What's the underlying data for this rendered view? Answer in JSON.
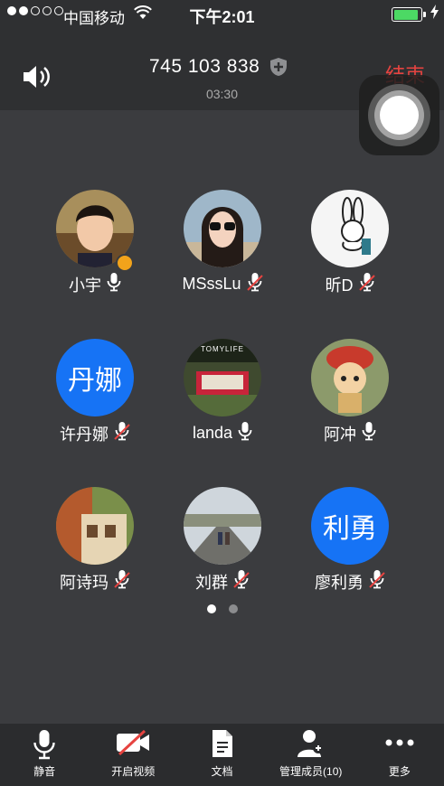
{
  "status_bar": {
    "carrier": "中国移动",
    "time": "下午2:01",
    "battery_level": 0.9,
    "colors": {
      "battery": "#4cd964"
    }
  },
  "call": {
    "meeting_id": "745 103 838",
    "duration": "03:30",
    "end_label_partial": "结束",
    "colors": {
      "end": "#e64340"
    }
  },
  "participants": [
    {
      "name": "小宇",
      "avatar": "photo",
      "host": true,
      "muted": false
    },
    {
      "name": "MSssLu",
      "avatar": "photo",
      "host": false,
      "muted": true
    },
    {
      "name": "昕D",
      "avatar": "photo",
      "host": false,
      "muted": true
    },
    {
      "name": "许丹娜",
      "avatar": "text",
      "avatar_text": "丹娜",
      "host": false,
      "muted": true
    },
    {
      "name": "landa",
      "avatar": "photo",
      "avatar_text": "TOMYLIFE",
      "host": false,
      "muted": false
    },
    {
      "name": "阿冲",
      "avatar": "photo",
      "host": false,
      "muted": false
    },
    {
      "name": "阿诗玛",
      "avatar": "photo",
      "host": false,
      "muted": true
    },
    {
      "name": "刘群",
      "avatar": "photo",
      "host": false,
      "muted": true
    },
    {
      "name": "廖利勇",
      "avatar": "text",
      "avatar_text": "利勇",
      "host": false,
      "muted": true
    }
  ],
  "pager": {
    "pages": 2,
    "current": 1
  },
  "toolbar": {
    "mute": "静音",
    "video": "开启视频",
    "docs": "文档",
    "manage": "管理成员(10)",
    "more": "更多"
  },
  "colors": {
    "text_avatar_bg": "#1673f5",
    "host_badge": "#f2a31b",
    "muted_slash": "#e64340"
  }
}
